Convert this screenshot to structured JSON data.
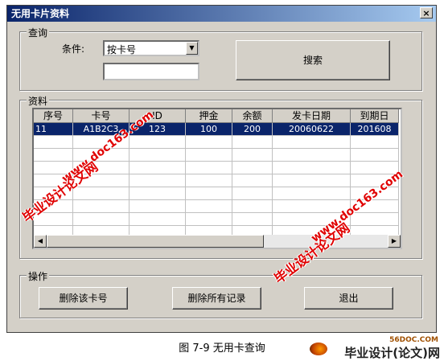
{
  "window": {
    "title": "无用卡片资料",
    "close_icon": "×"
  },
  "query": {
    "legend": "查询",
    "condition_label": "条件:",
    "condition_selected": "按卡号",
    "search_value": "",
    "search_button": "搜索"
  },
  "records": {
    "legend": "资料",
    "columns": [
      "序号",
      "卡号",
      "ID",
      "押金",
      "余额",
      "发卡日期",
      "到期日"
    ],
    "rows": [
      [
        "11",
        "A1B2C3",
        "123",
        "100",
        "200",
        "20060622",
        "201608"
      ]
    ]
  },
  "actions": {
    "legend": "操作",
    "delete_card_button": "删除该卡号",
    "delete_all_button": "删除所有记录",
    "exit_button": "退出"
  },
  "caption": "图 7-9 无用卡查询",
  "watermarks": [
    "www.doc163.com",
    "毕业设计论文网",
    "www.doc163.com",
    "毕业设计论文网"
  ],
  "logo": {
    "site": "56DOC.COM",
    "text": "毕业设计(论文)网"
  }
}
